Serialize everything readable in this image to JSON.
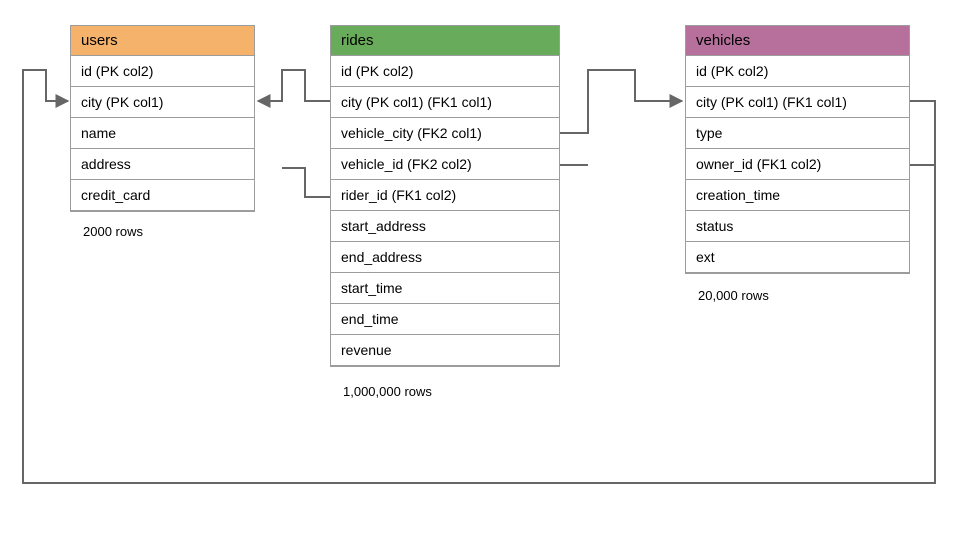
{
  "diagram": {
    "tables": {
      "users": {
        "title": "users",
        "rows": [
          "id (PK col2)",
          "city (PK col1)",
          "name",
          "address",
          "credit_card"
        ],
        "count": "2000 rows"
      },
      "rides": {
        "title": "rides",
        "rows": [
          "id (PK col2)",
          "city (PK col1) (FK1 col1)",
          "vehicle_city (FK2 col1)",
          "vehicle_id (FK2 col2)",
          "rider_id (FK1 col2)",
          "start_address",
          "end_address",
          "start_time",
          "end_time",
          "revenue"
        ],
        "count": "1,000,000 rows"
      },
      "vehicles": {
        "title": "vehicles",
        "rows": [
          "id (PK col2)",
          "city (PK col1) (FK1 col1)",
          "type",
          "owner_id (FK1 col2)",
          "creation_time",
          "status",
          "ext"
        ],
        "count": "20,000 rows"
      }
    }
  }
}
